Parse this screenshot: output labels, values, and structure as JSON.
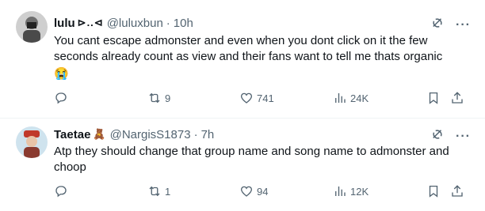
{
  "tweets": [
    {
      "name": "lulu",
      "name_deco": "⊳..⊲",
      "handle": "@luluxbun",
      "separator": "·",
      "time": "10h",
      "text": "You cant escape admonster and even when you dont click on it the few seconds already count as view and their fans want to tell me thats organic",
      "emoji": "😭",
      "reply_count": "",
      "retweet_count": "9",
      "like_count": "741",
      "view_count": "24K",
      "avatar_bg": "#cfcfcf"
    },
    {
      "name": "Taetae",
      "name_deco": "🧸",
      "handle": "@NargisS1873",
      "separator": "·",
      "time": "7h",
      "text": "Atp they should change that group name and song name to admonster and choop",
      "emoji": "",
      "reply_count": "",
      "retweet_count": "1",
      "like_count": "94",
      "view_count": "12K",
      "avatar_bg": "#cfe3ee"
    }
  ],
  "icons": {
    "grok": "grok-icon",
    "more": "more-icon",
    "reply": "reply-icon",
    "retweet": "retweet-icon",
    "like": "like-icon",
    "views": "views-icon",
    "bookmark": "bookmark-icon",
    "share": "share-icon"
  },
  "colors": {
    "text": "#0f1419",
    "secondary": "#536471",
    "divider": "#eff3f4"
  },
  "more_glyph": "···"
}
